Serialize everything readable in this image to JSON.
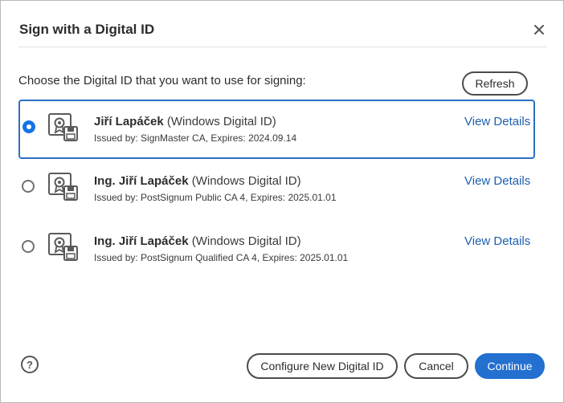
{
  "dialog": {
    "title": "Sign with a Digital ID",
    "prompt": "Choose the Digital ID that you want to use for signing:",
    "refresh_label": "Refresh"
  },
  "ids": [
    {
      "name": "Jiří Lapáček",
      "type": "(Windows Digital ID)",
      "issuer": "Issued by: SignMaster CA, Expires: 2024.09.14",
      "view_details": "View Details",
      "selected": true
    },
    {
      "name": "Ing. Jiří Lapáček",
      "type": "(Windows Digital ID)",
      "issuer": "Issued by: PostSignum Public CA 4, Expires: 2025.01.01",
      "view_details": "View Details",
      "selected": false
    },
    {
      "name": "Ing. Jiří Lapáček",
      "type": "(Windows Digital ID)",
      "issuer": "Issued by: PostSignum Qualified CA 4, Expires: 2025.01.01",
      "view_details": "View Details",
      "selected": false
    }
  ],
  "footer": {
    "help_glyph": "?",
    "configure_label": "Configure New Digital ID",
    "cancel_label": "Cancel",
    "continue_label": "Continue"
  },
  "icons": {
    "close": "close-icon",
    "certificate": "certificate-icon",
    "help": "help-icon"
  },
  "colors": {
    "accent": "#1473e6",
    "link": "#1d5fb0",
    "primary_button": "#2470d1"
  }
}
